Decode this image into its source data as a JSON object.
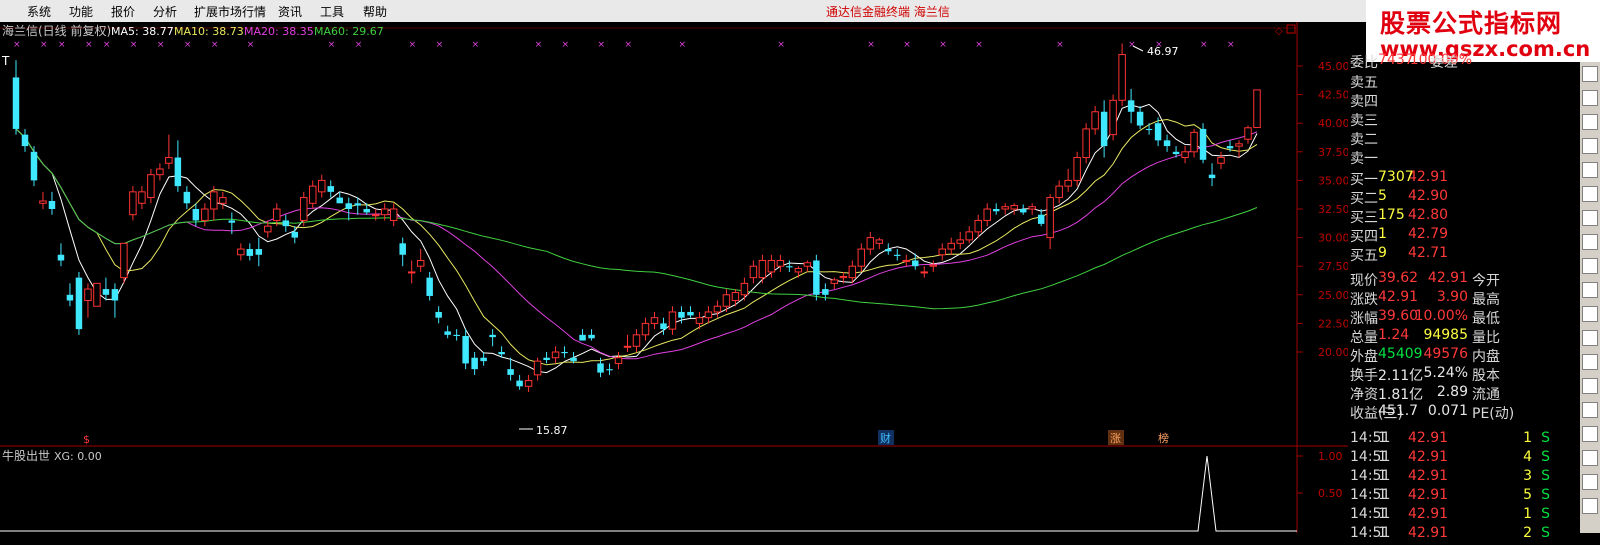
{
  "menu": [
    "系统",
    "功能",
    "报价",
    "分析",
    "扩展市场行情",
    "资讯",
    "工具",
    "帮助"
  ],
  "app_title": "通达信金融终端  海兰信",
  "logo": {
    "line1": "股票公式指标网",
    "line2": "www.gszx.com.cn"
  },
  "main_header": {
    "name": "海兰信(日线 前复权)",
    "ma5": "MA5: 38.77",
    "ma10": "MA10: 38.73",
    "ma20": "MA20: 38.35",
    "ma60": "MA60: 29.67"
  },
  "sub_header": {
    "name": "牛股出世",
    "xg": "XG: 0.00"
  },
  "annotations": {
    "high": "46.97",
    "low": "15.87",
    "t": "T",
    "cai": "财",
    "zhang": "涨",
    "bang": "榜",
    "s": "$"
  },
  "colors": {
    "up": "#ff3333",
    "down": "#40e8ff",
    "ma5": "#ffffff",
    "ma10": "#e8e860",
    "ma20": "#e040e0",
    "ma60": "#40d040",
    "axis": "#a00000",
    "text": "#c00000"
  },
  "chart_data": [
    {
      "type": "candlestick",
      "title": "海兰信(日线 前复权)",
      "ylim": [
        15,
        48
      ],
      "y_ticks": [
        "45.00",
        "42.50",
        "40.00",
        "37.50",
        "35.00",
        "32.50",
        "30.00",
        "27.50",
        "25.00",
        "22.50",
        "20.00"
      ],
      "candles": [
        [
          44,
          45.5,
          39,
          39.5
        ],
        [
          39,
          39.5,
          37.5,
          38
        ],
        [
          37.5,
          38,
          34.5,
          35
        ],
        [
          33,
          34,
          32.5,
          33.2
        ],
        [
          33.2,
          34,
          32,
          32.5
        ],
        [
          28.5,
          29.5,
          27.5,
          28
        ],
        [
          25,
          26,
          24,
          24.5
        ],
        [
          26.5,
          27,
          21.5,
          22
        ],
        [
          24.5,
          26,
          23,
          25.5
        ],
        [
          24,
          26,
          24,
          26
        ],
        [
          25.5,
          26.5,
          24.5,
          25
        ],
        [
          25.5,
          26,
          23,
          24.5
        ],
        [
          26.5,
          29.5,
          26,
          29.5
        ],
        [
          32,
          34.5,
          31.5,
          34
        ],
        [
          33,
          34.5,
          32.5,
          34
        ],
        [
          33.5,
          36,
          33,
          35.5
        ],
        [
          35.5,
          36.5,
          35,
          36
        ],
        [
          36.5,
          39,
          36,
          37
        ],
        [
          37,
          38.5,
          34,
          34.5
        ],
        [
          34,
          34.5,
          32.5,
          33
        ],
        [
          32.5,
          33,
          31,
          31.5
        ],
        [
          31.5,
          33,
          31,
          32.5
        ],
        [
          32.5,
          34.5,
          31.5,
          34
        ],
        [
          33,
          34,
          32.5,
          33.5
        ],
        [
          31.5,
          32.2,
          30.3,
          31.3
        ],
        [
          28.5,
          29.5,
          28,
          29
        ],
        [
          29,
          29.5,
          28,
          28.4
        ],
        [
          29,
          30,
          27.5,
          28.5
        ],
        [
          30.5,
          31.5,
          30,
          31
        ],
        [
          31.5,
          33,
          31,
          32.5
        ],
        [
          31.5,
          32,
          30.5,
          31
        ],
        [
          30.5,
          31,
          29.5,
          30
        ],
        [
          31.5,
          34,
          31,
          33.5
        ],
        [
          33,
          35,
          32.5,
          34.5
        ],
        [
          34,
          35.5,
          33.5,
          35
        ],
        [
          34.5,
          35,
          33.5,
          34
        ],
        [
          33.5,
          34,
          33,
          33
        ],
        [
          33,
          33.5,
          31.5,
          32.5
        ],
        [
          33,
          33.5,
          32,
          32.8
        ],
        [
          32.5,
          33,
          32,
          32.2
        ],
        [
          32,
          32.5,
          31.5,
          32
        ],
        [
          32,
          33,
          31.5,
          32.5
        ],
        [
          31.5,
          33,
          31,
          32.5
        ],
        [
          29.5,
          30,
          27.5,
          28.5
        ],
        [
          27,
          28,
          26,
          27
        ],
        [
          27.5,
          29,
          27,
          28
        ],
        [
          26.5,
          27,
          24.5,
          24.9
        ],
        [
          23.5,
          24,
          22.5,
          23
        ],
        [
          21.8,
          22.3,
          21.2,
          21.5
        ],
        [
          21.5,
          22,
          21,
          21.4
        ],
        [
          21.4,
          22,
          18.5,
          19
        ],
        [
          19.5,
          20,
          18,
          18.5
        ],
        [
          19.5,
          20,
          18.8,
          19.2
        ],
        [
          21.5,
          22,
          20.5,
          21.3
        ],
        [
          20,
          20.5,
          19.5,
          19.8
        ],
        [
          18.5,
          19.5,
          17.5,
          18
        ],
        [
          17.5,
          18,
          16.7,
          17
        ],
        [
          17,
          18,
          16.5,
          17.5
        ],
        [
          18,
          19.5,
          17.5,
          19.2
        ],
        [
          19.5,
          20,
          19,
          19.3
        ],
        [
          19.5,
          20.5,
          19,
          20
        ],
        [
          20,
          20.5,
          19.5,
          19.9
        ],
        [
          19.5,
          20,
          19,
          19.2
        ],
        [
          21.5,
          22,
          21,
          21
        ],
        [
          21.5,
          22,
          21,
          21.2
        ],
        [
          19,
          19.5,
          17.8,
          18.2
        ],
        [
          18.5,
          19,
          18,
          18.4
        ],
        [
          19,
          20,
          18.5,
          19.5
        ],
        [
          20.5,
          21.5,
          20,
          20.5
        ],
        [
          20.5,
          22,
          20,
          21.5
        ],
        [
          21.5,
          23,
          21,
          22.5
        ],
        [
          22.5,
          23.5,
          22,
          23
        ],
        [
          22.5,
          23,
          21.5,
          22
        ],
        [
          22,
          24,
          21.5,
          23.5
        ],
        [
          23.5,
          24,
          22.5,
          23
        ],
        [
          23.5,
          24,
          23,
          23.2
        ],
        [
          22.5,
          23.5,
          22,
          23
        ],
        [
          23,
          24,
          22.5,
          23.5
        ],
        [
          23.5,
          24.5,
          23,
          24
        ],
        [
          24,
          25.5,
          23.5,
          25
        ],
        [
          24.5,
          25.5,
          24,
          25.2
        ],
        [
          25,
          26.5,
          24.5,
          26
        ],
        [
          26.5,
          28,
          26,
          27.5
        ],
        [
          26.5,
          28.5,
          26,
          28
        ],
        [
          27,
          28.5,
          26.5,
          28
        ],
        [
          27.5,
          28.5,
          27,
          28
        ],
        [
          27.5,
          28,
          27,
          27.4
        ],
        [
          27,
          27.5,
          26.5,
          27.3
        ],
        [
          27.5,
          28,
          27,
          27.8
        ],
        [
          28,
          28.5,
          24.5,
          25
        ],
        [
          25.5,
          26,
          24.5,
          25
        ],
        [
          26,
          26.5,
          25.5,
          26.3
        ],
        [
          26.5,
          27,
          26,
          26.6
        ],
        [
          26.5,
          28,
          26,
          27.5
        ],
        [
          27.5,
          29.5,
          27,
          29
        ],
        [
          29,
          30.5,
          28.5,
          30
        ],
        [
          29.5,
          30,
          29,
          29.8
        ],
        [
          29,
          29.5,
          28.5,
          28.8
        ],
        [
          28.5,
          29,
          28,
          28.4
        ],
        [
          28,
          28.5,
          27.5,
          28
        ],
        [
          28,
          28.6,
          27.2,
          27.5
        ],
        [
          27,
          27.5,
          26.5,
          27
        ],
        [
          27.5,
          28,
          27,
          27.6
        ],
        [
          28.5,
          29.5,
          28,
          29
        ],
        [
          29,
          30,
          28.5,
          29.5
        ],
        [
          29.5,
          30.5,
          29,
          29.8
        ],
        [
          29.8,
          31,
          29.5,
          30.5
        ],
        [
          30.5,
          32,
          30,
          31.5
        ],
        [
          31.5,
          33,
          31,
          32.5
        ],
        [
          32.5,
          33,
          32,
          32.3
        ],
        [
          32.5,
          33,
          32,
          32.7
        ],
        [
          32.5,
          33,
          32,
          32.8
        ],
        [
          32.5,
          32.9,
          32,
          32.2
        ],
        [
          32.5,
          33,
          32,
          32.7
        ],
        [
          32,
          32.5,
          31,
          31.2
        ],
        [
          30,
          33.8,
          29,
          33.5
        ],
        [
          33.5,
          35,
          33,
          34.5
        ],
        [
          34.5,
          36,
          34,
          35
        ],
        [
          35,
          37.5,
          34.5,
          37
        ],
        [
          37,
          40,
          36.5,
          39.5
        ],
        [
          39.5,
          41.5,
          39,
          41
        ],
        [
          41,
          42,
          37,
          38
        ],
        [
          39,
          42.5,
          38.5,
          42
        ],
        [
          42,
          46.97,
          41.5,
          46
        ],
        [
          42,
          43,
          40,
          41
        ],
        [
          41,
          41.5,
          39.5,
          39.8
        ],
        [
          39.5,
          40,
          39,
          39.4
        ],
        [
          40,
          40.5,
          38,
          38.5
        ],
        [
          38.5,
          39,
          37.5,
          38
        ],
        [
          37.5,
          38,
          37,
          37.3
        ],
        [
          37,
          38,
          36.5,
          37.5
        ],
        [
          37.5,
          39.5,
          37,
          39.2
        ],
        [
          39.5,
          40,
          36.5,
          36.8
        ],
        [
          35.5,
          36.5,
          34.5,
          35.2
        ],
        [
          36.5,
          37.5,
          36,
          37
        ],
        [
          38,
          38.5,
          37.5,
          37.8
        ],
        [
          38,
          38.5,
          37,
          38.2
        ],
        [
          38.6,
          39.8,
          38.2,
          39.6
        ],
        [
          39.62,
          42.91,
          39.6,
          42.91
        ]
      ],
      "ma": {
        "MA5": 38.77,
        "MA10": 38.73,
        "MA20": 38.35,
        "MA60": 29.67
      },
      "annotations": {
        "high": 46.97,
        "low": 15.87
      }
    },
    {
      "type": "line",
      "title": "牛股出世",
      "ylim": [
        0,
        1.1
      ],
      "y_ticks": [
        "1.00",
        "0.50"
      ],
      "series": [
        {
          "name": "XG",
          "signal_index": 151,
          "values_note": "single spike 1.00"
        }
      ]
    }
  ],
  "quote": {
    "top_row": {
      "l1": "委比",
      "v1": "100.00%",
      "l2": "委差",
      "v2": "7437"
    },
    "sell": [
      {
        "label": "卖五",
        "price": "",
        "vol": ""
      },
      {
        "label": "卖四",
        "price": "",
        "vol": ""
      },
      {
        "label": "卖三",
        "price": "",
        "vol": ""
      },
      {
        "label": "卖二",
        "price": "",
        "vol": ""
      },
      {
        "label": "卖一",
        "price": "",
        "vol": ""
      }
    ],
    "buy": [
      {
        "label": "买一",
        "price": "42.91",
        "vol": "7307"
      },
      {
        "label": "买二",
        "price": "42.90",
        "vol": "5"
      },
      {
        "label": "买三",
        "price": "42.80",
        "vol": "175"
      },
      {
        "label": "买四",
        "price": "42.79",
        "vol": "1"
      },
      {
        "label": "买五",
        "price": "42.71",
        "vol": "9"
      }
    ],
    "stats": [
      {
        "l1": "现价",
        "v1": "42.91",
        "c1": "red",
        "l2": "今开",
        "v2": "39.62",
        "c2": "red"
      },
      {
        "l1": "涨跌",
        "v1": "3.90",
        "c1": "red",
        "l2": "最高",
        "v2": "42.91",
        "c2": "red"
      },
      {
        "l1": "涨幅",
        "v1": "10.00%",
        "c1": "red",
        "l2": "最低",
        "v2": "39.60",
        "c2": "red"
      },
      {
        "l1": "总量",
        "v1": "94985",
        "c1": "yel",
        "l2": "量比",
        "v2": "1.24",
        "c2": "red"
      },
      {
        "l1": "外盘",
        "v1": "49576",
        "c1": "red",
        "l2": "内盘",
        "v2": "45409",
        "c2": "grn"
      },
      {
        "l1": "换手",
        "v1": "5.24%",
        "c1": "wht",
        "l2": "股本",
        "v2": "2.11亿",
        "c2": "wht"
      },
      {
        "l1": "净资",
        "v1": "2.89",
        "c1": "wht",
        "l2": "流通",
        "v2": "1.81亿",
        "c2": "wht"
      },
      {
        "l1": "收益(三)",
        "v1": "0.071",
        "c1": "wht",
        "l2": "PE(动)",
        "v2": "451.7",
        "c2": "wht"
      }
    ],
    "ticks": [
      {
        "time": "14:51",
        "price": "42.91",
        "vol": "1",
        "side": "S",
        "n": "1"
      },
      {
        "time": "14:51",
        "price": "42.91",
        "vol": "4",
        "side": "S",
        "n": "1"
      },
      {
        "time": "14:51",
        "price": "42.91",
        "vol": "3",
        "side": "S",
        "n": "1"
      },
      {
        "time": "14:51",
        "price": "42.91",
        "vol": "5",
        "side": "S",
        "n": "1"
      },
      {
        "time": "14:51",
        "price": "42.91",
        "vol": "1",
        "side": "S",
        "n": "1"
      },
      {
        "time": "14:51",
        "price": "42.91",
        "vol": "2",
        "side": "S",
        "n": "1"
      }
    ]
  },
  "sidebar_icons": [
    "chart-icon",
    "kline-icon",
    "bar-icon",
    "list-icon",
    "graph-icon",
    "f10-icon",
    "grid-icon",
    "info-icon",
    "f1-icon",
    "f2-icon",
    "line-icon",
    "rsi-icon",
    "scroll-icon",
    "tool-icon",
    "flag-icon",
    "mark-icon",
    "plus-icon",
    "minus-icon",
    "arrow-icon"
  ]
}
